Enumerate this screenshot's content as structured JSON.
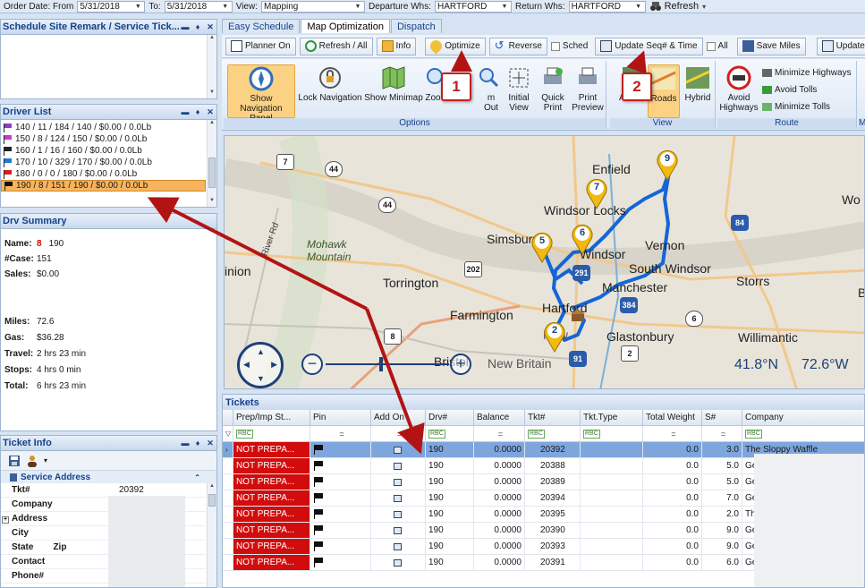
{
  "topbar": {
    "order_date_label": "Order Date: From",
    "order_date_from": "5/31/2018",
    "to_label": "To:",
    "order_date_to": "5/31/2018",
    "view_label": "View:",
    "view_value": "Mapping",
    "departure_label": "Departure Whs:",
    "departure_value": "HARTFORD",
    "return_label": "Return Whs:",
    "return_value": "HARTFORD",
    "refresh_label": "Refresh"
  },
  "panels": {
    "remark_title": "Schedule Site Remark / Service Tick...",
    "driver_list_title": "Driver List",
    "drv_summary_title": "Drv Summary",
    "ticket_info_title": "Ticket Info"
  },
  "driver_list": [
    {
      "text": "140  / 11 / 184 / 140 / $0.00 / 0.0Lb",
      "color": "#8a3fc4"
    },
    {
      "text": "150  / 8 / 124 / 150 / $0.00 / 0.0Lb",
      "color": "#c03fc4"
    },
    {
      "text": "160  / 1 / 16 / 160 / $0.00 / 0.0Lb",
      "color": "#222222"
    },
    {
      "text": "170  / 10 / 329 / 170 / $0.00 / 0.0Lb",
      "color": "#1e78d8"
    },
    {
      "text": "180  / 0 / 0 / 180 / $0.00 / 0.0Lb",
      "color": "#d81e1e"
    },
    {
      "text": "190  / 8 / 151 / 190 / $0.00 / 0.0Lb",
      "color": "#111111"
    }
  ],
  "summary": {
    "name_label": "Name:",
    "name_num": "8",
    "name_value": "190",
    "case_label": "#Case:",
    "case_value": "151",
    "sales_label": "Sales:",
    "sales_value": "$0.00",
    "miles_label": "Miles:",
    "miles_value": "72.6",
    "gas_label": "Gas:",
    "gas_value": "$36.28",
    "travel_label": "Travel:",
    "travel_value": "2 hrs 23 min",
    "stops_label": "Stops:",
    "stops_value": "4 hrs 0 min",
    "total_label": "Total:",
    "total_value": "6 hrs 23 min"
  },
  "ticket_info": {
    "section": "Service Address",
    "rows": [
      {
        "k": "Tkt#",
        "v": "20392"
      },
      {
        "k": "Company",
        "v": ""
      },
      {
        "k": "Address",
        "v": ""
      },
      {
        "k": "City",
        "v": ""
      },
      {
        "k": "State",
        "k2": "Zip",
        "v": ""
      },
      {
        "k": "Contact",
        "v": ""
      },
      {
        "k": "Phone#",
        "v": ""
      }
    ]
  },
  "tabs": [
    {
      "label": "Easy Schedule",
      "active": false
    },
    {
      "label": "Map Optimization",
      "active": true
    },
    {
      "label": "Dispatch",
      "active": false
    }
  ],
  "toolbar": {
    "planner_on": "Planner On",
    "refresh_all": "Refresh / All",
    "info": "Info",
    "optimize": "Optimize",
    "reverse": "Reverse",
    "sched": "Sched",
    "update_seq": "Update Seq# & Time",
    "all": "All",
    "save_miles": "Save Miles",
    "update_l": "Update L"
  },
  "ribbon": {
    "show_nav": [
      "Show Navigation",
      "Panel"
    ],
    "lock_nav": "Lock Navigation",
    "show_minimap": "Show Minimap",
    "zoom": "Zoo",
    "zoom_out": "m Out",
    "initial_view": [
      "Initial",
      "View"
    ],
    "quick_print": [
      "Quick",
      "Print"
    ],
    "print_preview": [
      "Print",
      "Preview"
    ],
    "options_label": "Options",
    "aerial": "A",
    "roads": "Roads",
    "hybrid": "Hybrid",
    "view_label": "View",
    "avoid_highways": [
      "Avoid",
      "Highways"
    ],
    "minimize_highways": "Minimize Highways",
    "avoid_tolls": "Avoid Tolls",
    "minimize_tolls": "Minimize Tolls",
    "route_label": "Route",
    "mi_label": "Mi"
  },
  "map": {
    "places": [
      {
        "name": "Enfield"
      },
      {
        "name": "Windsor Locks"
      },
      {
        "name": "Simsbury"
      },
      {
        "name": "Windsor"
      },
      {
        "name": "Vernon"
      },
      {
        "name": "South Windsor"
      },
      {
        "name": "Manchester"
      },
      {
        "name": "Storrs"
      },
      {
        "name": "Torrington"
      },
      {
        "name": "Farmington"
      },
      {
        "name": "Hartford"
      },
      {
        "name": "New"
      },
      {
        "name": "Glastonbury"
      },
      {
        "name": "Willimantic"
      },
      {
        "name": "Bristol"
      },
      {
        "name": "New Britain"
      },
      {
        "name": "Mohawk"
      },
      {
        "name": "Mountain"
      },
      {
        "name": "Wo"
      },
      {
        "name": "B"
      },
      {
        "name": "inion"
      },
      {
        "name": "River Rd"
      }
    ],
    "pins": [
      "9",
      "7",
      "6",
      "5",
      "2"
    ],
    "lat": "41.8°N",
    "lon": "72.6°W"
  },
  "tickets": {
    "title": "Tickets",
    "columns": [
      "Prep/Imp St...",
      "Pin",
      "Add On",
      "Drv#",
      "Balance",
      "Tkt#",
      "Tkt.Type",
      "Total Weight",
      "S#",
      "Company"
    ],
    "rows": [
      {
        "status": "NOT PREPA...",
        "drv": "190",
        "balance": "0.0000",
        "tkt": "20392",
        "weight": "0.0",
        "s": "3.0",
        "company": "The Sloppy Waffle"
      },
      {
        "status": "NOT PREPA...",
        "drv": "190",
        "balance": "0.0000",
        "tkt": "20388",
        "weight": "0.0",
        "s": "5.0",
        "company": "Geis"
      },
      {
        "status": "NOT PREPA...",
        "drv": "190",
        "balance": "0.0000",
        "tkt": "20389",
        "weight": "0.0",
        "s": "5.0",
        "company": "Geis"
      },
      {
        "status": "NOT PREPA...",
        "drv": "190",
        "balance": "0.0000",
        "tkt": "20394",
        "weight": "0.0",
        "s": "7.0",
        "company": "Geis"
      },
      {
        "status": "NOT PREPA...",
        "drv": "190",
        "balance": "0.0000",
        "tkt": "20395",
        "weight": "0.0",
        "s": "2.0",
        "company": "The"
      },
      {
        "status": "NOT PREPA...",
        "drv": "190",
        "balance": "0.0000",
        "tkt": "20390",
        "weight": "0.0",
        "s": "9.0",
        "company": "Geis"
      },
      {
        "status": "NOT PREPA...",
        "drv": "190",
        "balance": "0.0000",
        "tkt": "20393",
        "weight": "0.0",
        "s": "9.0",
        "company": "Geis"
      },
      {
        "status": "NOT PREPA...",
        "drv": "190",
        "balance": "0.0000",
        "tkt": "20391",
        "weight": "0.0",
        "s": "6.0",
        "company": "Geis"
      }
    ]
  },
  "callouts": [
    "1",
    "2"
  ],
  "colors": {
    "accent": "#15428b",
    "status_red": "#d20c0c",
    "route_blue": "#1565d8",
    "pin_yellow": "#f3b90f",
    "arrow_red": "#b21414"
  }
}
